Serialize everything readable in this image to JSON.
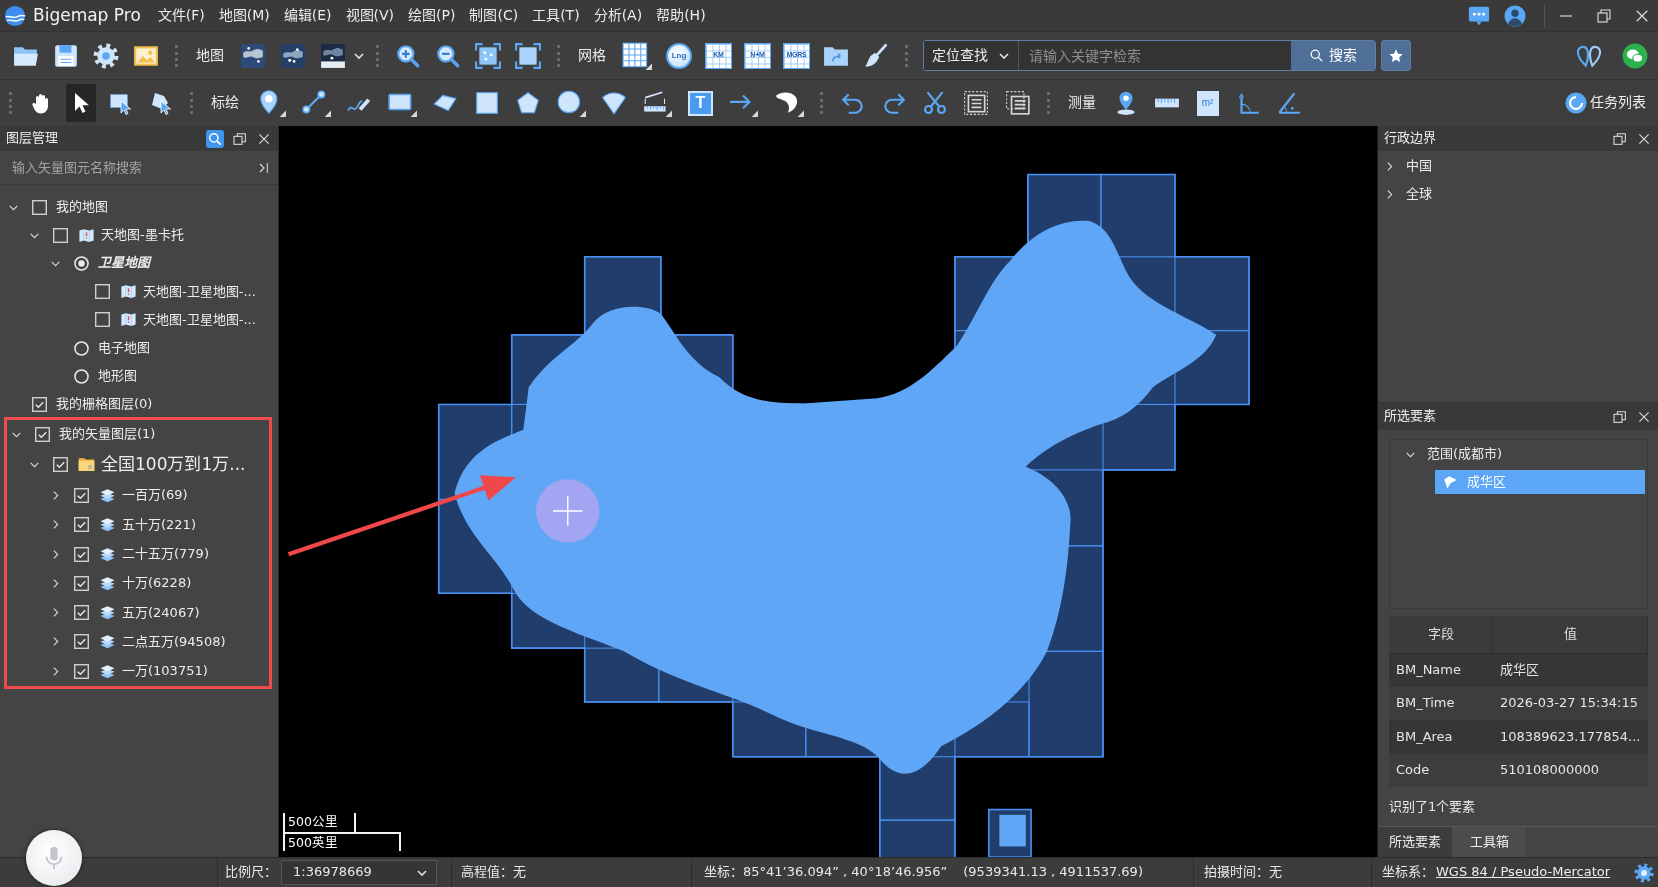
{
  "app": {
    "title": "Bigemap Pro",
    "menu": [
      "文件(F)",
      "地图(M)",
      "编辑(E)",
      "视图(V)",
      "绘图(P)",
      "制图(C)",
      "工具(T)",
      "分析(A)",
      "帮助(H)"
    ]
  },
  "toolbar_main": {
    "map_label": "地图",
    "grid_label": "网格",
    "grid_buttons": [
      {
        "label": "Lng",
        "kind": "globe"
      },
      {
        "label": "KM",
        "kind": "grid"
      },
      {
        "label": "N+M",
        "kind": "grid"
      },
      {
        "label": "MGRS",
        "kind": "grid"
      }
    ],
    "search": {
      "mode": "定位查找",
      "placeholder": "请输入关键字检索",
      "button": "搜索"
    }
  },
  "toolbar_draw": {
    "select_tools": [
      {
        "kind": "hand",
        "selected": false
      },
      {
        "kind": "pointer",
        "selected": true
      },
      {
        "kind": "box-select",
        "selected": false
      },
      {
        "kind": "shape-select",
        "selected": false
      }
    ],
    "plot_label": "标绘",
    "text_tool": "T",
    "measure_label": "测量",
    "area_tool": "m²",
    "tasks_button": "任务列表"
  },
  "layer_panel": {
    "title": "图层管理",
    "search_placeholder": "输入矢量图元名称搜索",
    "tree": [
      {
        "label": "我的地图",
        "kind": "group",
        "checked": false,
        "expanded": true,
        "highlighted": false,
        "children": [
          {
            "label": "天地图-墨卡托",
            "kind": "map",
            "checked": false,
            "expanded": true,
            "children": [
              {
                "label": "卫星地图",
                "kind": "style",
                "selected": true,
                "expanded": true,
                "children": [
                  {
                    "label": "天地图-卫星地图-...",
                    "kind": "map",
                    "checked": false
                  },
                  {
                    "label": "天地图-卫星地图-...",
                    "kind": "map",
                    "checked": false
                  }
                ]
              },
              {
                "label": "电子地图",
                "kind": "style",
                "selected": false
              },
              {
                "label": "地形图",
                "kind": "style",
                "selected": false
              }
            ]
          }
        ]
      },
      {
        "label": "我的栅格图层(0)",
        "kind": "group",
        "checked": true,
        "highlighted": false
      },
      {
        "label": "我的矢量图层(1)",
        "kind": "group",
        "checked": true,
        "expanded": true,
        "highlighted": true,
        "children": [
          {
            "label": "全国100万到1万...",
            "kind": "folder",
            "checked": true,
            "expanded": true,
            "children": [
              {
                "label": "一百万(69)",
                "kind": "layer",
                "checked": true,
                "expanded": false
              },
              {
                "label": "五十万(221)",
                "kind": "layer",
                "checked": true,
                "expanded": false
              },
              {
                "label": "二十五万(779)",
                "kind": "layer",
                "checked": true,
                "expanded": false
              },
              {
                "label": "十万(6228)",
                "kind": "layer",
                "checked": true,
                "expanded": false
              },
              {
                "label": "五万(24067)",
                "kind": "layer",
                "checked": true,
                "expanded": false
              },
              {
                "label": "二点五万(94508)",
                "kind": "layer",
                "checked": true,
                "expanded": false
              },
              {
                "label": "一万(103751)",
                "kind": "layer",
                "checked": true,
                "expanded": false
              }
            ]
          }
        ]
      }
    ]
  },
  "map": {
    "scale_metric": "500公里",
    "scale_imperial": "500英里"
  },
  "boundary_panel": {
    "title": "行政边界",
    "items": [
      {
        "label": "中国",
        "expanded": false
      },
      {
        "label": "全球",
        "expanded": false
      }
    ]
  },
  "selection_panel": {
    "title": "所选要素",
    "tree": [
      {
        "label": "范围(成都市)",
        "expanded": true,
        "children": [
          {
            "label": "成华区",
            "selected": true
          }
        ]
      }
    ],
    "table": {
      "columns": [
        "字段",
        "值"
      ],
      "rows": [
        [
          "BM_Name",
          "成华区"
        ],
        [
          "BM_Time",
          "2026-03-27 15:34:15"
        ],
        [
          "BM_Area",
          "108389623.177854..."
        ],
        [
          "Code",
          "510108000000"
        ]
      ]
    },
    "summary": "识别了1个要素"
  },
  "dock_tabs": [
    {
      "label": "所选要素",
      "selected": true
    },
    {
      "label": "工具箱",
      "selected": false
    }
  ],
  "status_bar": {
    "scale_label": "比例尺：",
    "scale_value": "1:36978669",
    "elevation": "高程值：无",
    "coordinates": "坐标：85°41’36.094” , 40°18’46.956”",
    "projected": "(9539341.13 , 4911537.69)",
    "capture_time": "拍摄时间：无",
    "crs_label": "坐标系：",
    "crs_value": "WGS 84 / Pseudo-Mercator"
  }
}
